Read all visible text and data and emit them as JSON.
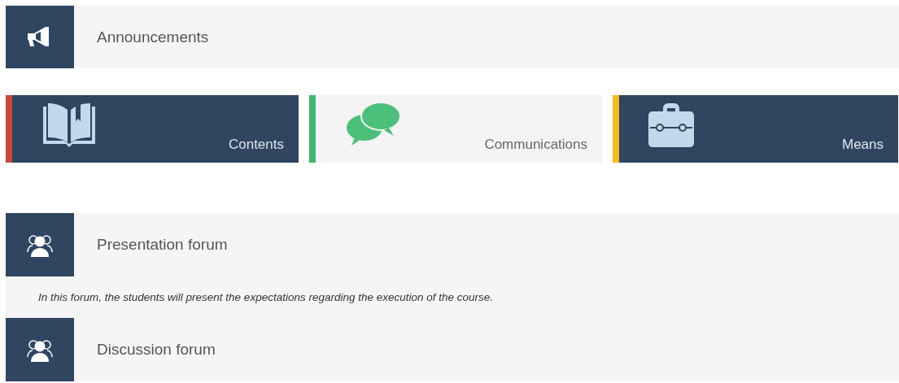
{
  "announcements": {
    "label": "Announcements"
  },
  "tiles": [
    {
      "label": "Contents",
      "kind": "dark",
      "color": "#c8473a"
    },
    {
      "label": "Communications",
      "kind": "light",
      "color": "#3dba6f"
    },
    {
      "label": "Means",
      "kind": "dark",
      "color": "#f0bd1a"
    }
  ],
  "forums": [
    {
      "name": "Presentation forum",
      "description": "In this forum, the students will present the expectations regarding the execution of the course."
    },
    {
      "name": "Discussion forum"
    }
  ]
}
